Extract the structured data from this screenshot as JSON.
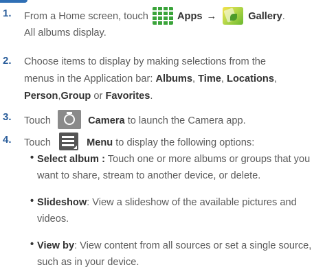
{
  "steps": [
    {
      "number": "1.",
      "lines": {
        "prefix": "From a Home screen, touch",
        "apps_label": "Apps",
        "arrow": "→",
        "gallery_label": "Gallery",
        "suffix": ".",
        "line2": "All albums display."
      }
    },
    {
      "number": "2.",
      "lines": {
        "line1": "Choose items to display by making selections from the",
        "line2_prefix": "menus in the Application bar:",
        "albums": "Albums",
        "time": "Time",
        "locations": "Locations",
        "sep": ",",
        "person": "Person",
        "group": "Group",
        "or": "or",
        "favorites": "Favorites",
        "period": "."
      }
    },
    {
      "number": "3.",
      "lines": {
        "prefix": "Touch",
        "camera_label": "Camera",
        "suffix": "to launch the Camera app."
      }
    },
    {
      "number": "4.",
      "lines": {
        "prefix": "Touch",
        "menu_label": "Menu",
        "suffix": "to display the following options:"
      }
    }
  ],
  "options": [
    {
      "bullet": "•",
      "term": "Select album :",
      "line1": " Touch one or more albums or groups that you",
      "line2": "want to share, stream to another device, or delete."
    },
    {
      "bullet": "•",
      "term": "Slideshow",
      "line1": ": View a slideshow of the available pictures and",
      "line2": "videos."
    },
    {
      "bullet": "•",
      "term": "View by",
      "line1": ": View content from all sources or set a single source,",
      "line2": "such as in your device."
    }
  ],
  "icons": {
    "apps": "apps-grid-icon",
    "gallery": "gallery-icon",
    "camera": "camera-icon",
    "menu": "menu-icon"
  },
  "colors": {
    "step_number": "#2b5e9b",
    "body_text": "#5b5b5b",
    "bold_text": "#333333",
    "apps_icon": "#3aa43a"
  }
}
